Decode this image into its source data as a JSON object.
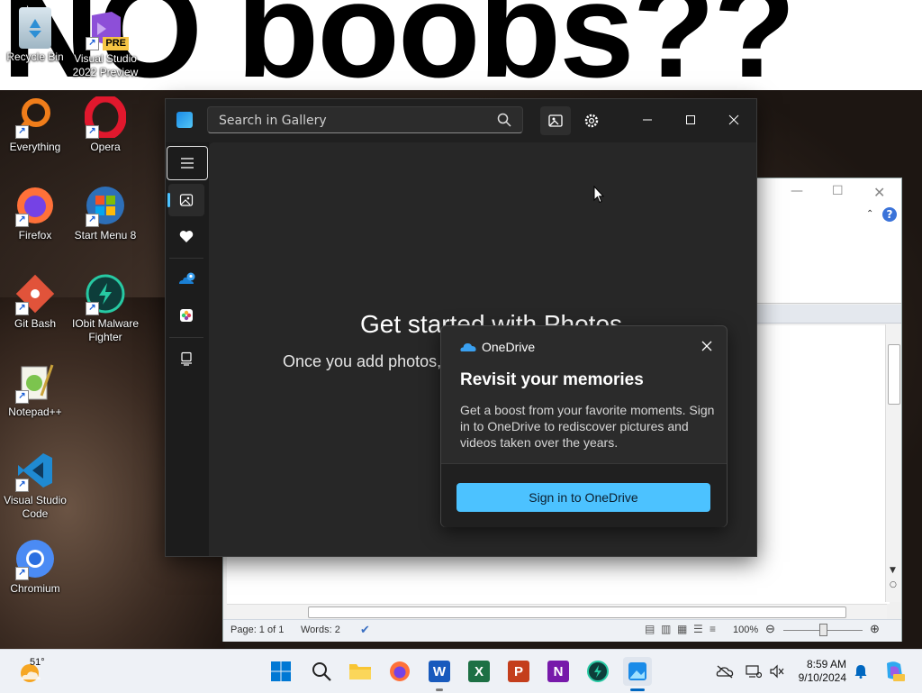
{
  "wallpaper": {
    "text": "NO boobs??"
  },
  "desktop": {
    "icons": [
      {
        "label": "Recycle Bin"
      },
      {
        "label": "Visual Studio 2022 Preview",
        "badge": "PRE"
      },
      {
        "label": "Everything"
      },
      {
        "label": "Opera"
      },
      {
        "label": "Firefox"
      },
      {
        "label": "Start Menu 8"
      },
      {
        "label": "Git Bash"
      },
      {
        "label": "IObit Malware Fighter"
      },
      {
        "label": "Notepad++"
      },
      {
        "label": "Visual Studio Code"
      },
      {
        "label": "Chromium"
      }
    ]
  },
  "photos": {
    "search_placeholder": "Search in Gallery",
    "heading": "Get started with Photos",
    "subtext": "Once you add photos,",
    "nav": [
      "menu-icon",
      "gallery-icon",
      "favorites-icon",
      "onedrive-icon",
      "icloud-icon",
      "this-pc-icon"
    ]
  },
  "onedrive_popup": {
    "brand": "OneDrive",
    "title": "Revisit your memories",
    "body": "Get a boost from your favorite moments. Sign in to OneDrive to rediscover pictures and videos taken over the years.",
    "button": "Sign in to OneDrive"
  },
  "word": {
    "status_page": "Page: 1 of 1",
    "status_words": "Words: 2",
    "zoom": "100%"
  },
  "taskbar": {
    "temperature": "51°",
    "time": "8:59 AM",
    "date": "9/10/2024",
    "apps": [
      "start",
      "search",
      "file-explorer",
      "firefox",
      "word",
      "excel",
      "powerpoint",
      "onenote",
      "iobit",
      "photos"
    ]
  },
  "colors": {
    "accent": "#4cc2ff",
    "photos_bg": "#202020",
    "taskbar_bg": "#eef1f6"
  }
}
